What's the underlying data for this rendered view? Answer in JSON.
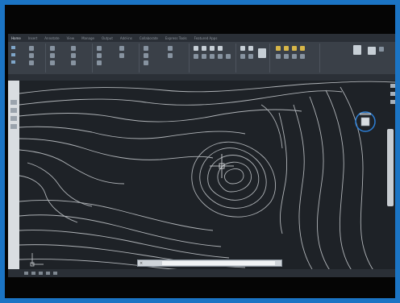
{
  "ribbon": {
    "tabs": [
      "Home",
      "Insert",
      "Annotate",
      "View",
      "Manage",
      "Output",
      "Add-ins",
      "Collaborate",
      "Express Tools",
      "Featured Apps"
    ],
    "active_tab": "Home"
  },
  "colors": {
    "frame_border": "#1b74c4",
    "canvas_background": "#1e2227",
    "contour_line": "#c9cdd1",
    "crosshair": "#e6e9ec",
    "viewcube_ring": "#2d7fd6"
  },
  "icons": {
    "viewcube": "viewcube-icon",
    "crosshair": "crosshair-cursor-icon",
    "ucs": "ucs-icon",
    "close": "close-icon"
  }
}
